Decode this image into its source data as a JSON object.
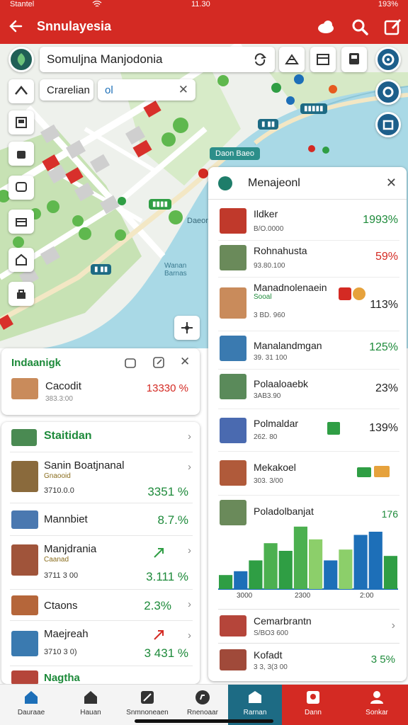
{
  "status_bar": {
    "carrier": "Stantel",
    "time": "11.30",
    "battery": "193%"
  },
  "app_bar": {
    "title": "Snnulayesia"
  },
  "search": {
    "value": "Somuljna Manjodonia"
  },
  "chips": {
    "filter_label": "Crarelian",
    "tag_label": "ol"
  },
  "map_labels": {
    "banner": "Daon Baeo",
    "place_1": "Daeon",
    "place_2": "Wanan Barnas"
  },
  "left_card": {
    "title": "Indaanigk",
    "item_name": "Cacodit",
    "item_sub": "383.3:00",
    "item_value": "13330 %"
  },
  "left_list": {
    "header": "Staitidan",
    "rows": [
      {
        "name": "Sanin Boatjnanal",
        "sub2": "Gnaooid",
        "sub": "3710.0.0",
        "value": "3351 %"
      },
      {
        "name": "Mannbiet",
        "sub2": "",
        "sub": "",
        "value": "8.7.%"
      },
      {
        "name": "Manjdrania",
        "sub2": "Caanad",
        "sub": "3711 3 00",
        "value": "3.111 %"
      },
      {
        "name": "Ctaons",
        "sub2": "",
        "sub": "",
        "value": "2.3%"
      },
      {
        "name": "Maejreah",
        "sub2": "",
        "sub": "3710 3 0)",
        "value": "3 431 %"
      },
      {
        "name": "Nagtha",
        "sub2": "",
        "sub": "",
        "value": ""
      }
    ]
  },
  "right_panel": {
    "title": "Menajeonl",
    "rows": [
      {
        "name": "Ildker",
        "sub2": "",
        "sub": "B/O.0000",
        "value": "1993%",
        "value_color": "#1d8a3a"
      },
      {
        "name": "Rohnahusta",
        "sub2": "",
        "sub": "93.80.100",
        "value": "59%",
        "value_color": "#d42a23"
      },
      {
        "name": "Manadnolenaein",
        "sub2": "Sooal",
        "sub": "3 BD. 960",
        "value": "113%",
        "value_color": "#1d8a3a"
      },
      {
        "name": "Manalandmgan",
        "sub2": "",
        "sub": "39. 31 100",
        "value": "125%",
        "value_color": "#1d8a3a"
      },
      {
        "name": "Polaaloaebk",
        "sub2": "",
        "sub": "3AB3.90",
        "value": "23%",
        "value_color": "#1d8a3a"
      },
      {
        "name": "Polmaldar",
        "sub2": "",
        "sub": "262. 80",
        "value": "139%",
        "value_color": "#d42a23"
      },
      {
        "name": "Mekakoel",
        "sub2": "",
        "sub": "303. 3/00",
        "value": "",
        "value_color": "#1d8a3a"
      }
    ],
    "chart_header": "Poladolbanjat",
    "chart_header_value": "176",
    "bottom_rows": [
      {
        "name": "Cemarbrantn",
        "sub": "S/BO3 600"
      },
      {
        "name": "Kofadt",
        "sub": "3 3, 3(3 00",
        "value": "3 5%"
      }
    ]
  },
  "chart_data": {
    "type": "bar",
    "xlabel": "",
    "ylabel": "",
    "x_tick_labels": [
      "3000",
      "2300",
      "2:00"
    ],
    "ylim": [
      0,
      100
    ],
    "values": [
      22,
      28,
      45,
      72,
      60,
      98,
      78,
      45,
      62,
      85,
      90,
      52
    ],
    "colors": [
      "#2f9e44",
      "#1d6fb8",
      "#2f9e44",
      "#4cb050",
      "#2f9e44",
      "#4cb050",
      "#8ccf6a",
      "#1d6fb8",
      "#8ccf6a",
      "#1d6fb8",
      "#1d6fb8",
      "#2f9e44"
    ]
  },
  "bottom_nav": [
    {
      "label": "Dauraae",
      "icon": "home-icon"
    },
    {
      "label": "Hauan",
      "icon": "house-icon"
    },
    {
      "label": "Snmnoneaen",
      "icon": "tools-icon"
    },
    {
      "label": "Rnenoaar",
      "icon": "compass-icon"
    },
    {
      "label": "Rarnan",
      "icon": "shop-icon"
    },
    {
      "label": "Dann",
      "icon": "alert-icon"
    },
    {
      "label": "Sonkar",
      "icon": "profile-icon"
    }
  ],
  "colors": {
    "brand": "#d42a23",
    "accent_green": "#1d8a3a",
    "accent_teal": "#1d6b84"
  }
}
